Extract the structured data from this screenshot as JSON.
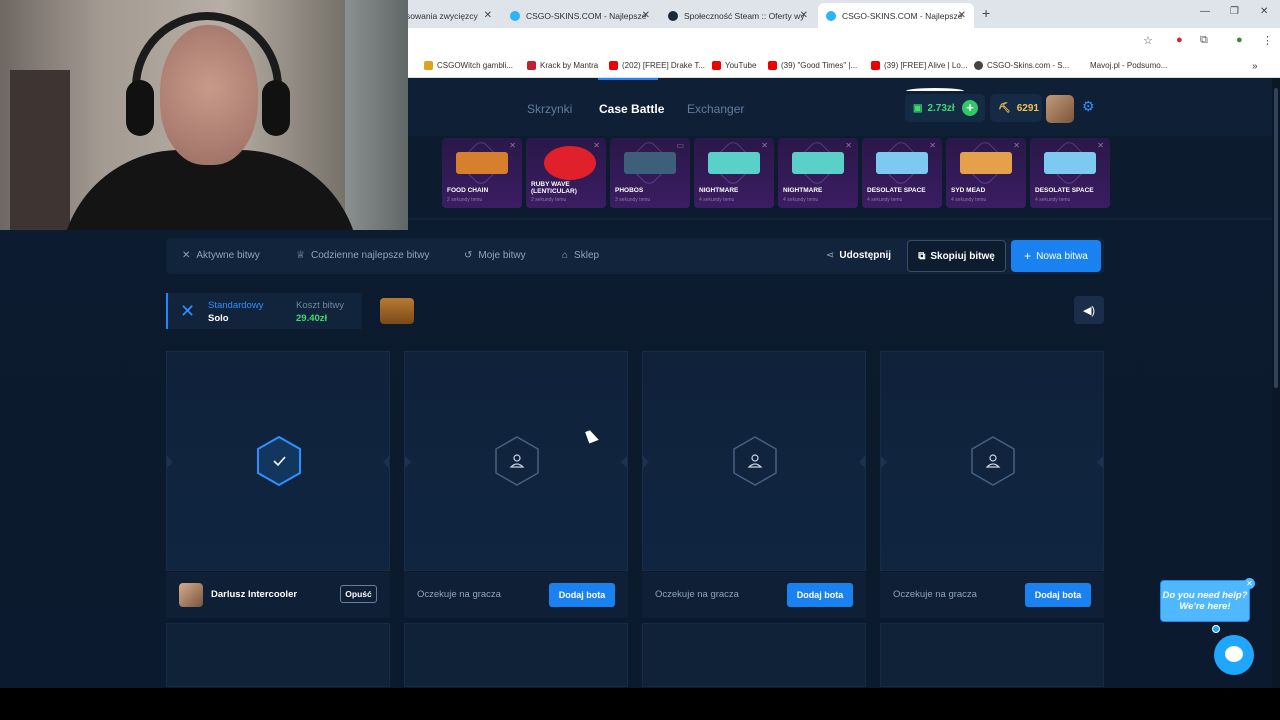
{
  "browser": {
    "tabs": [
      {
        "label": "sowania zwycięzcy",
        "active": false
      },
      {
        "label": "CSGO-SKINS.COM - Najlepsze",
        "active": false
      },
      {
        "label": "Społeczność Steam :: Oferty wy",
        "active": false
      },
      {
        "label": "CSGO-SKINS.COM - Najlepsze",
        "active": true
      }
    ],
    "bookmarks": [
      "CSGOWitch gambli...",
      "Krack by Mantra",
      "(202) [FREE] Drake T...",
      "YouTube",
      "(39) \"Good Times\" |...",
      "(39) [FREE] Alive | Lo...",
      "CSGO-Skins.com - S...",
      "Mavoj.pl - Podsumo..."
    ]
  },
  "nav": {
    "cases": "Skrzynki",
    "case_battle": "Case Battle",
    "exchanger": "Exchanger",
    "balance": "2.73zł",
    "coins": "6291"
  },
  "drops": [
    {
      "name": "FOOD CHAIN",
      "time": "2 sekundy temu",
      "color": "#d6802e"
    },
    {
      "name": "RUBY WAVE (LENTICULAR)",
      "time": "2 sekundy temu",
      "color": "#e0202a"
    },
    {
      "name": "PHOBOS",
      "time": "3 sekundy temu",
      "color": "#3d5f7a"
    },
    {
      "name": "NIGHTMARE",
      "time": "4 sekundy temu",
      "color": "#5ad0c8"
    },
    {
      "name": "NIGHTMARE",
      "time": "4 sekundy temu",
      "color": "#5ad0c8"
    },
    {
      "name": "DESOLATE SPACE",
      "time": "4 sekundy temu",
      "color": "#7ec9f0"
    },
    {
      "name": "SYD MEAD",
      "time": "4 sekundy temu",
      "color": "#e4a14a"
    },
    {
      "name": "DESOLATE SPACE",
      "time": "4 sekundy temu",
      "color": "#7ec9f0"
    }
  ],
  "actions": {
    "active": "Aktywne bitwy",
    "daily": "Codzienne najlepsze bitwy",
    "mine": "Moje bitwy",
    "shop": "Sklep",
    "share": "Udostępnij",
    "copy": "Skopiuj bitwę",
    "new": "Nowa bitwa"
  },
  "battle": {
    "mode": "Standardowy",
    "type": "Solo",
    "cost_label": "Koszt bitwy",
    "cost": "29.40zł"
  },
  "slots": {
    "player_name": "Darlusz Intercooler",
    "leave": "Opuść",
    "waiting": "Oczekuje na gracza",
    "add_bot": "Dodaj bota"
  },
  "help": {
    "line1": "Do you need help?",
    "line2": "We're here!"
  }
}
